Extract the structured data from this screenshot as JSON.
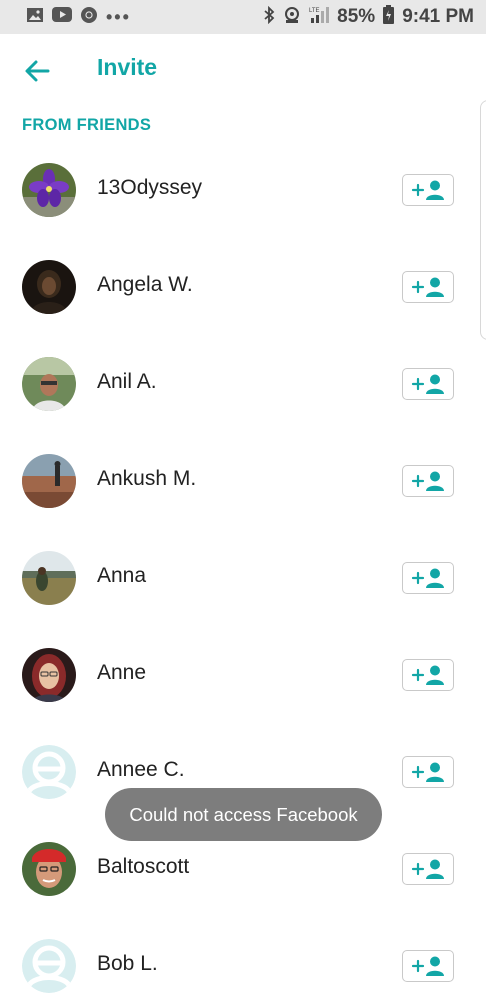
{
  "status_bar": {
    "left_icons": [
      "gallery-icon",
      "youtube-icon",
      "chrome-icon"
    ],
    "more": "•••",
    "right_icons": [
      "bluetooth-icon",
      "hotspot-icon",
      "lte-signal-icon",
      "battery-icon"
    ],
    "battery": "85%",
    "time": "9:41 PM"
  },
  "header": {
    "title": "Invite"
  },
  "section": {
    "label": "FROM FRIENDS"
  },
  "friends": [
    {
      "name": "13Odyssey",
      "avatar": "flower"
    },
    {
      "name": "Angela W.",
      "avatar": "dark-photo"
    },
    {
      "name": "Anil A.",
      "avatar": "man-photo"
    },
    {
      "name": "Ankush M.",
      "avatar": "landscape-photo"
    },
    {
      "name": "Anna",
      "avatar": "field-photo"
    },
    {
      "name": "Anne",
      "avatar": "cartoon-woman"
    },
    {
      "name": "Annee C.",
      "avatar": "placeholder"
    },
    {
      "name": "Baltoscott",
      "avatar": "man-red-hat"
    },
    {
      "name": "Bob L.",
      "avatar": "placeholder"
    }
  ],
  "toast": {
    "message": "Could not access Facebook"
  },
  "colors": {
    "accent": "#12a6a6",
    "toast_bg": "#7d7d7d",
    "status_bar_bg": "#e8e8e8"
  }
}
